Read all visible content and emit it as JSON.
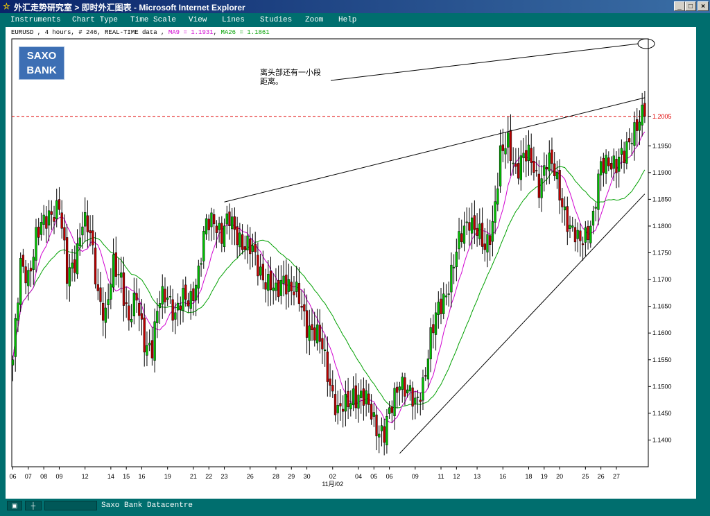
{
  "window": {
    "title": "外汇走势研究室 > 即时外汇图表 - Microsoft Internet Explorer",
    "buttons": [
      "_",
      "□",
      "×"
    ]
  },
  "menu": {
    "items": [
      "Instruments",
      "Chart Type",
      "Time Scale",
      "View",
      "Lines",
      "Studies",
      "Zoom",
      "Help"
    ]
  },
  "info": {
    "symbol": "EURUSD , 4 hours, # 246, REAL-TIME data ,",
    "ma9": "MA9 = 1.1931",
    "ma26": "MA26 = 1.1861"
  },
  "logo": {
    "line1": "SAXO",
    "line2": "BANK"
  },
  "annotation": {
    "line1": "离头部还有一小段",
    "line2": "距离。"
  },
  "status": {
    "text": "Saxo Bank Datacentre"
  },
  "colors": {
    "frame": "#006e6e",
    "up": "#00c000",
    "down": "#c00000",
    "ma9": "#d000d0",
    "ma26": "#00a000",
    "refline": "#e00000"
  },
  "chart_data": {
    "type": "candlestick",
    "ylim": [
      1.135,
      1.215
    ],
    "y_ticks": [
      "1.1400",
      "1.1450",
      "1.1500",
      "1.1550",
      "1.1600",
      "1.1650",
      "1.1700",
      "1.1750",
      "1.1800",
      "1.1850",
      "1.1900",
      "1.1950",
      "1.2005"
    ],
    "y_tick_values": [
      1.14,
      1.145,
      1.15,
      1.155,
      1.16,
      1.165,
      1.17,
      1.175,
      1.18,
      1.185,
      1.19,
      1.195,
      1.2005
    ],
    "reference_line": 1.2005,
    "x_ticks": [
      "06",
      "07",
      "08",
      "09",
      "12",
      "14",
      "15",
      "16",
      "19",
      "21",
      "22",
      "23",
      "26",
      "28",
      "29",
      "30",
      "02",
      "04",
      "05",
      "06",
      "09",
      "11",
      "12",
      "13",
      "16",
      "18",
      "19",
      "20",
      "25",
      "26",
      "27"
    ],
    "x_tick_index": [
      0,
      6,
      12,
      18,
      28,
      38,
      44,
      50,
      60,
      70,
      76,
      82,
      92,
      102,
      108,
      114,
      124,
      134,
      140,
      146,
      156,
      166,
      172,
      180,
      190,
      200,
      206,
      212,
      222,
      228,
      234
    ],
    "x_month_label": "11月/02",
    "anchors": [
      [
        0,
        1.155
      ],
      [
        3,
        1.172
      ],
      [
        6,
        1.171
      ],
      [
        9,
        1.178
      ],
      [
        12,
        1.18
      ],
      [
        15,
        1.183
      ],
      [
        18,
        1.184
      ],
      [
        21,
        1.17
      ],
      [
        24,
        1.174
      ],
      [
        27,
        1.181
      ],
      [
        30,
        1.178
      ],
      [
        33,
        1.168
      ],
      [
        36,
        1.163
      ],
      [
        39,
        1.172
      ],
      [
        42,
        1.171
      ],
      [
        45,
        1.162
      ],
      [
        48,
        1.166
      ],
      [
        51,
        1.159
      ],
      [
        54,
        1.157
      ],
      [
        57,
        1.166
      ],
      [
        60,
        1.168
      ],
      [
        63,
        1.163
      ],
      [
        66,
        1.166
      ],
      [
        69,
        1.167
      ],
      [
        72,
        1.171
      ],
      [
        75,
        1.18
      ],
      [
        78,
        1.182
      ],
      [
        81,
        1.178
      ],
      [
        84,
        1.181
      ],
      [
        87,
        1.179
      ],
      [
        90,
        1.176
      ],
      [
        93,
        1.175
      ],
      [
        96,
        1.172
      ],
      [
        99,
        1.169
      ],
      [
        102,
        1.167
      ],
      [
        105,
        1.171
      ],
      [
        108,
        1.168
      ],
      [
        111,
        1.166
      ],
      [
        114,
        1.162
      ],
      [
        117,
        1.16
      ],
      [
        120,
        1.157
      ],
      [
        123,
        1.151
      ],
      [
        126,
        1.145
      ],
      [
        129,
        1.146
      ],
      [
        132,
        1.149
      ],
      [
        135,
        1.148
      ],
      [
        138,
        1.146
      ],
      [
        141,
        1.143
      ],
      [
        144,
        1.141
      ],
      [
        147,
        1.146
      ],
      [
        150,
        1.152
      ],
      [
        153,
        1.149
      ],
      [
        156,
        1.146
      ],
      [
        159,
        1.151
      ],
      [
        162,
        1.159
      ],
      [
        165,
        1.164
      ],
      [
        168,
        1.168
      ],
      [
        171,
        1.173
      ],
      [
        174,
        1.178
      ],
      [
        177,
        1.182
      ],
      [
        180,
        1.179
      ],
      [
        183,
        1.175
      ],
      [
        186,
        1.181
      ],
      [
        189,
        1.193
      ],
      [
        192,
        1.195
      ],
      [
        195,
        1.191
      ],
      [
        198,
        1.193
      ],
      [
        201,
        1.192
      ],
      [
        204,
        1.188
      ],
      [
        207,
        1.192
      ],
      [
        210,
        1.19
      ],
      [
        213,
        1.185
      ],
      [
        216,
        1.179
      ],
      [
        219,
        1.177
      ],
      [
        222,
        1.179
      ],
      [
        225,
        1.181
      ],
      [
        228,
        1.191
      ],
      [
        231,
        1.193
      ],
      [
        234,
        1.191
      ],
      [
        237,
        1.193
      ],
      [
        240,
        1.198
      ],
      [
        245,
        1.2005
      ]
    ],
    "bars": 246,
    "trend_lines": [
      {
        "from": [
          82,
          1.1845
        ],
        "to": [
          245,
          1.204
        ]
      },
      {
        "from": [
          150,
          1.1375
        ],
        "to": [
          245,
          1.186
        ]
      }
    ]
  }
}
